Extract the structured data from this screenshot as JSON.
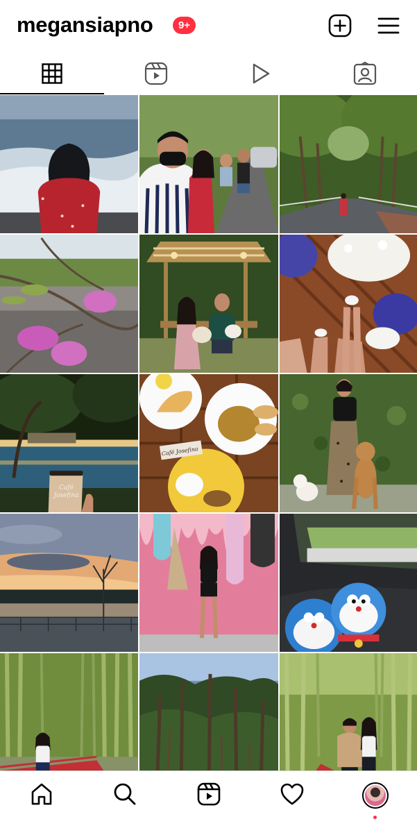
{
  "header": {
    "username": "megansiapno",
    "notification_badge": "9+",
    "icons": {
      "create": "plus-square-icon",
      "menu": "hamburger-menu-icon"
    }
  },
  "tabs": [
    {
      "name": "posts",
      "icon": "grid-icon",
      "active": true
    },
    {
      "name": "reels",
      "icon": "reels-icon",
      "active": false
    },
    {
      "name": "videos",
      "icon": "play-icon",
      "active": false
    },
    {
      "name": "tagged",
      "icon": "tagged-person-icon",
      "active": false
    }
  ],
  "grid": {
    "posts": [
      {
        "scene": "woman-at-ocean-shore"
      },
      {
        "scene": "group-selfie-on-tree-road"
      },
      {
        "scene": "woman-on-tree-tunnel-road"
      },
      {
        "scene": "pink-flowers-on-branches"
      },
      {
        "scene": "couple-with-dog-under-pergola"
      },
      {
        "scene": "flowers-and-sandals-on-wood-floor"
      },
      {
        "scene": "cafe-josefina-cup-at-night-lake",
        "printed_text": "Café Josefina"
      },
      {
        "scene": "food-plates-on-table",
        "printed_text": "Café Josefina"
      },
      {
        "scene": "woman-with-dogs-by-hedge"
      },
      {
        "scene": "sunset-over-lake"
      },
      {
        "scene": "woman-in-front-of-pink-drip-wall"
      },
      {
        "scene": "doraemon-plushies-in-car"
      },
      {
        "scene": "woman-in-bamboo-forest"
      },
      {
        "scene": "pine-forest"
      },
      {
        "scene": "couple-in-bamboo-forest"
      }
    ]
  },
  "bottom_nav": [
    {
      "name": "home",
      "icon": "home-icon"
    },
    {
      "name": "search",
      "icon": "search-icon"
    },
    {
      "name": "reels",
      "icon": "reels-icon"
    },
    {
      "name": "activity",
      "icon": "heart-icon"
    },
    {
      "name": "profile",
      "icon": "profile-avatar"
    }
  ],
  "colors": {
    "badge": "#ff3040",
    "divider": "#dbdbdb"
  }
}
